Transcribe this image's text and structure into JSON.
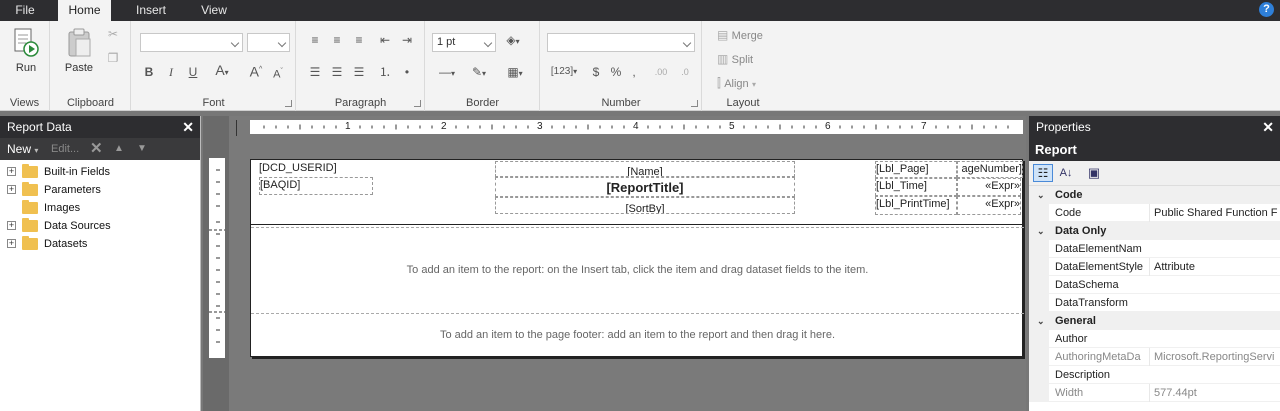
{
  "tabs": [
    {
      "label": "File"
    },
    {
      "label": "Home"
    },
    {
      "label": "Insert"
    },
    {
      "label": "View"
    }
  ],
  "help_glyph": "?",
  "ribbon": {
    "views": {
      "run_label": "Run",
      "group_label": "Views"
    },
    "clipboard": {
      "paste_label": "Paste",
      "group_label": "Clipboard"
    },
    "font": {
      "group_label": "Font"
    },
    "paragraph": {
      "group_label": "Paragraph"
    },
    "border": {
      "width_value": "1 pt",
      "group_label": "Border"
    },
    "number": {
      "group_label": "Number"
    },
    "layout": {
      "merge_label": "Merge",
      "split_label": "Split",
      "align_label": "Align",
      "group_label": "Layout"
    }
  },
  "report_data": {
    "title": "Report Data",
    "close_glyph": "✕",
    "new_label": "New",
    "edit_label": "Edit...",
    "items": [
      {
        "label": "Built-in Fields",
        "expander": "+"
      },
      {
        "label": "Parameters",
        "expander": "+"
      },
      {
        "label": "Images",
        "expander": ""
      },
      {
        "label": "Data Sources",
        "expander": "+"
      },
      {
        "label": "Datasets",
        "expander": "+"
      }
    ]
  },
  "ruler": {
    "numbers": [
      "1",
      "2",
      "3",
      "4",
      "5",
      "6",
      "7"
    ]
  },
  "report": {
    "header": {
      "dcd_userid": "[DCD_USERID]",
      "baqid": "[BAQID]",
      "name": "[Name]",
      "report_title": "[ReportTitle]",
      "sort_by": "[SortBy]",
      "lbl_page": "[Lbl_Page]",
      "page_number": "ageNumber]",
      "lbl_time": "[Lbl_Time]",
      "expr1": "«Expr»",
      "lbl_print_time": "[Lbl_PrintTime]",
      "expr2": "«Expr»"
    },
    "body_hint": "To add an item to the report: on the Insert tab, click the item and drag dataset fields to the item.",
    "footer_hint": "To add an item to the page footer: add an item to the report and then drag it here."
  },
  "properties": {
    "pane_title": "Properties",
    "close_glyph": "✕",
    "object_name": "Report",
    "categories": [
      {
        "name": "Code",
        "rows": [
          {
            "name": "Code",
            "value": "Public Shared Function F"
          }
        ]
      },
      {
        "name": "Data Only",
        "rows": [
          {
            "name": "DataElementNam",
            "value": ""
          },
          {
            "name": "DataElementStyle",
            "value": "Attribute"
          },
          {
            "name": "DataSchema",
            "value": ""
          },
          {
            "name": "DataTransform",
            "value": ""
          }
        ]
      },
      {
        "name": "General",
        "rows": [
          {
            "name": "Author",
            "value": ""
          },
          {
            "name": "AuthoringMetaDa",
            "value": "Microsoft.ReportingServi"
          },
          {
            "name": "Description",
            "value": ""
          },
          {
            "name": "Width",
            "value": "577.44pt"
          }
        ]
      }
    ]
  }
}
